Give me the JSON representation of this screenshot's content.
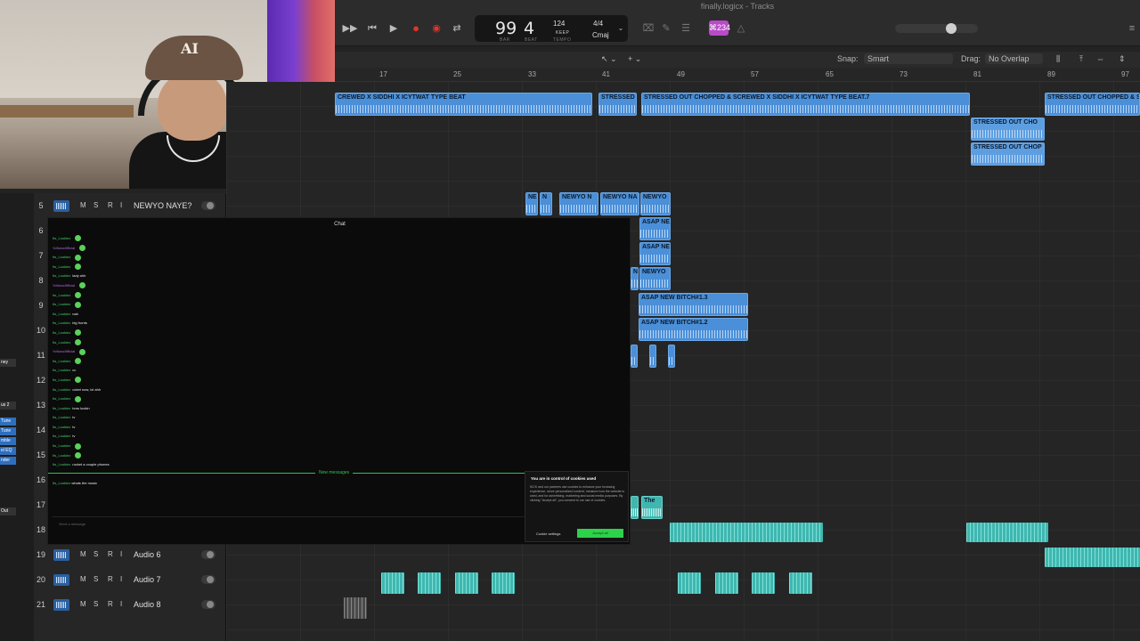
{
  "window": {
    "title": "finally.logicx - Tracks"
  },
  "lcd": {
    "bar": "99",
    "beat": "4",
    "bar_label": "BAR",
    "beat_label": "BEAT",
    "tempo": "124",
    "tempo_mode": "KEEP",
    "tempo_label": "TEMPO",
    "signature": "4/4",
    "key": "Cmaj"
  },
  "badge": "⌘234",
  "snap": {
    "snap_label": "Snap:",
    "snap_value": "Smart",
    "drag_label": "Drag:",
    "drag_value": "No Overlap"
  },
  "ruler_ticks": [
    "17",
    "25",
    "33",
    "41",
    "49",
    "57",
    "65",
    "73",
    "81",
    "89",
    "97"
  ],
  "regions": {
    "top1": "CREWED X SIDDHI X ICYTWAT TYPE BEAT",
    "top2": "STRESSED",
    "top3": "STRESSED OUT CHOPPED & SCREWED X SIDDHI X ICYTWAT TYPE BEAT.7",
    "top4": "STRESSED OUT CHOPPED & S",
    "chop1": "STRESSED OUT CHO",
    "chop2": "STRESSED OUT CHOP",
    "ne": "NE",
    "n": "N",
    "newyo1": "NEWYO N",
    "newyo2": "NEWYO NA",
    "newyo3": "NEWYO",
    "asap1": "ASAP NE",
    "asap2": "ASAP NE",
    "na": "NA",
    "newyo4": "NEWYO",
    "bitch1": "ASAP NEW BITCH#1.3",
    "bitch2": "ASAP NEW BITCH#1.2",
    "the": "The"
  },
  "tracks": [
    {
      "num": "5",
      "name": "NEWYO NAYE?"
    },
    {
      "num": "6",
      "name": ""
    },
    {
      "num": "7",
      "name": ""
    },
    {
      "num": "8",
      "name": ""
    },
    {
      "num": "9",
      "name": ""
    },
    {
      "num": "10",
      "name": ""
    },
    {
      "num": "11",
      "name": ""
    },
    {
      "num": "12",
      "name": ""
    },
    {
      "num": "13",
      "name": ""
    },
    {
      "num": "14",
      "name": ""
    },
    {
      "num": "15",
      "name": ""
    },
    {
      "num": "16",
      "name": ""
    },
    {
      "num": "17",
      "name": ""
    },
    {
      "num": "18",
      "name": ""
    },
    {
      "num": "19",
      "name": "Audio 6"
    },
    {
      "num": "20",
      "name": "Audio 7"
    },
    {
      "num": "21",
      "name": "Audio 8"
    }
  ],
  "track_buttons": {
    "m": "M",
    "s": "S",
    "r": "R",
    "i": "I"
  },
  "left_strip": [
    "ney",
    "us 2",
    "Tune",
    "Tune",
    "mble",
    "el EQ",
    "nder",
    "Out"
  ],
  "webcam": {
    "cap_logo": "AI"
  },
  "chat": {
    "title": "Chat",
    "messages": [
      {
        "user": "Its_Lookiez",
        "text": "",
        "color": "green"
      },
      {
        "user": "YoNanc0fficial",
        "text": "",
        "color": "purple"
      },
      {
        "user": "Its_Lookiez",
        "text": "",
        "color": "green"
      },
      {
        "user": "Its_Lookiez",
        "text": "",
        "color": "green"
      },
      {
        "user": "Its_Lookiez",
        "text": "lady ahh",
        "color": "green"
      },
      {
        "user": "YoNanc0fficial",
        "text": "",
        "color": "purple"
      },
      {
        "user": "Its_Lookiez",
        "text": "",
        "color": "green"
      },
      {
        "user": "Its_Lookiez",
        "text": "",
        "color": "green"
      },
      {
        "user": "Its_Lookiez",
        "text": "nah",
        "color": "green"
      },
      {
        "user": "Its_Lookiez",
        "text": "big fronts",
        "color": "green"
      },
      {
        "user": "Its_Lookiez",
        "text": "",
        "color": "green"
      },
      {
        "user": "Its_Lookiez",
        "text": "",
        "color": "green"
      },
      {
        "user": "YoNanc0fficial",
        "text": "",
        "color": "purple"
      },
      {
        "user": "Its_Lookiez",
        "text": "",
        "color": "green"
      },
      {
        "user": "Its_Lookiez",
        "text": "cc",
        "color": "green"
      },
      {
        "user": "Its_Lookiez",
        "text": "",
        "color": "green"
      },
      {
        "user": "Its_Lookiez",
        "text": "ocket now, lol ahh",
        "color": "green"
      },
      {
        "user": "Its_Lookiez",
        "text": "",
        "color": "green"
      },
      {
        "user": "Its_Lookiez",
        "text": "bros lookin",
        "color": "green"
      },
      {
        "user": "Its_Lookiez",
        "text": "tv",
        "color": "green"
      },
      {
        "user": "Its_Lookiez",
        "text": "tv",
        "color": "green"
      },
      {
        "user": "Its_Lookiez",
        "text": "tv",
        "color": "green"
      },
      {
        "user": "Its_Lookiez",
        "text": "",
        "color": "green"
      },
      {
        "user": "Its_Lookiez",
        "text": "",
        "color": "green"
      },
      {
        "user": "Its_Lookiez",
        "text": "rocket a couple phones",
        "color": "green"
      }
    ],
    "new_messages": "New messages",
    "last_message": {
      "user": "Its_Lookiez",
      "text": "whats the music"
    },
    "input_placeholder": "Send a message",
    "cookie": {
      "title": "You are in control of cookies used",
      "body": "KICK and our partners use cookies to enhance your browsing experience, serve personalized content, measure how the website is used, and for advertising, marketing and social media purposes. By clicking \"Accept all\", you consent to our use of cookies.",
      "settings": "Cookie settings",
      "accept": "Accept all"
    }
  },
  "colors": {
    "region_blue": "#4a8fd8",
    "region_teal": "#3fb7b0",
    "record": "#e0352b",
    "badge": "#b74cc6",
    "chat_green": "#3fd46a"
  }
}
